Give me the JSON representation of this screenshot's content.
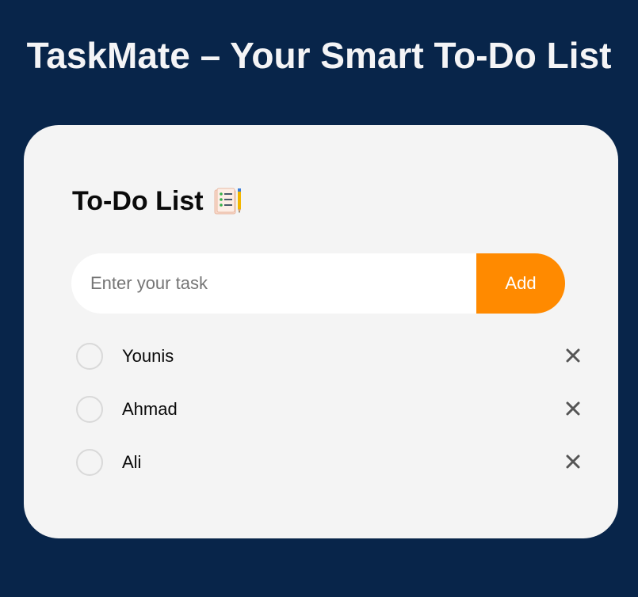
{
  "header": {
    "title": "TaskMate – Your Smart To-Do List"
  },
  "card": {
    "heading": "To-Do List",
    "heading_icon": "notepad-checklist-icon"
  },
  "input": {
    "placeholder": "Enter your task",
    "value": ""
  },
  "add_button": {
    "label": "Add"
  },
  "tasks": [
    {
      "text": "Younis",
      "checked": false,
      "delete_icon": "close-icon"
    },
    {
      "text": "Ahmad",
      "checked": false,
      "delete_icon": "close-icon"
    },
    {
      "text": "Ali",
      "checked": false,
      "delete_icon": "close-icon"
    }
  ],
  "colors": {
    "page_background": "#08254a",
    "card_background": "#f4f4f4",
    "accent": "#ff8a00",
    "title_text": "#f4f4f6",
    "circle_border": "#d9d9d9",
    "delete_icon": "#555555"
  }
}
